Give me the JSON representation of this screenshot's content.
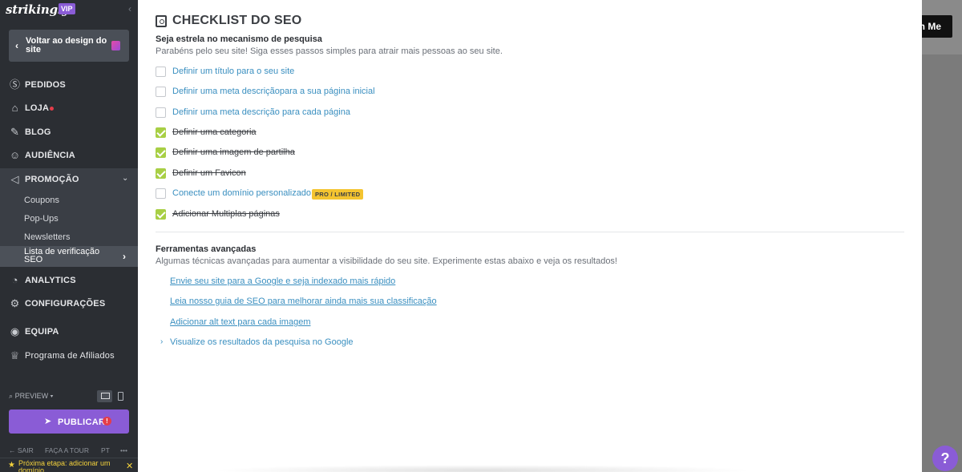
{
  "sidebar": {
    "logo": "strikingly",
    "vip": "VIP",
    "back_label": "Voltar ao design do site",
    "nav": {
      "pedidos": "PEDIDOS",
      "loja": "LOJA",
      "blog": "BLOG",
      "audiencia": "AUDIÊNCIA",
      "promocao": "PROMOÇÃO",
      "analytics": "ANALYTICS",
      "configuracoes": "CONFIGURAÇÕES",
      "equipa": "EQUIPA",
      "afiliados": "Programa de Afiliados"
    },
    "promo_sub": {
      "coupons": "Coupons",
      "popups": "Pop-Ups",
      "newsletters": "Newsletters",
      "seo_checklist": "Lista de verificação SEO"
    },
    "preview": "PREVIEW",
    "publish": "PUBLICAR",
    "publish_alert": "!",
    "footer": {
      "sair": "SAIR",
      "tour": "FAÇA A TOUR",
      "lang": "PT",
      "more": "•••"
    },
    "next_step": "Próxima etapa: adicionar um domínio"
  },
  "background": {
    "button_text": "h Me",
    "help": "?"
  },
  "panel": {
    "title": "CHECKLIST DO SEO",
    "section1_heading": "Seja estrela no mecanismo de pesquisa",
    "section1_sub": "Parabéns pelo seu site! Siga esses passos simples para atrair mais pessoas ao seu site.",
    "checklist": [
      {
        "label": "Definir um título para o seu site",
        "done": false
      },
      {
        "label": "Definir uma meta descriçãopara a sua página inicial",
        "done": false
      },
      {
        "label": "Definir uma meta descrição para cada página",
        "done": false
      },
      {
        "label": "Definir uma categoria",
        "done": true
      },
      {
        "label": "Definir uma imagem de partilha",
        "done": true
      },
      {
        "label": "Definir um Favicon",
        "done": true
      },
      {
        "label": "Conecte um domínio personalizado",
        "done": false,
        "badge": "PRO / LIMITED"
      },
      {
        "label": "Adicionar Multiplas páginas",
        "done": true
      }
    ],
    "section2_heading": "Ferramentas avançadas",
    "section2_sub": "Algumas técnicas avançadas para aumentar a visibilidade do seu site. Experimente estas abaixo e veja os resultados!",
    "advanced_links": [
      "Envie seu site para a Google e seja indexado mais rápido",
      "Leia nosso guia de SEO para melhorar ainda mais sua classificação",
      "Adicionar alt text para cada imagem"
    ],
    "google_preview": "Visualize os resultados da pesquisa no Google"
  },
  "colors": {
    "sidebar_bg": "#2b2e33",
    "accent_purple": "#8a5cd6",
    "link_blue": "#3a8fc0",
    "check_green": "#a8cf45",
    "badge_yellow": "#f4c430"
  }
}
